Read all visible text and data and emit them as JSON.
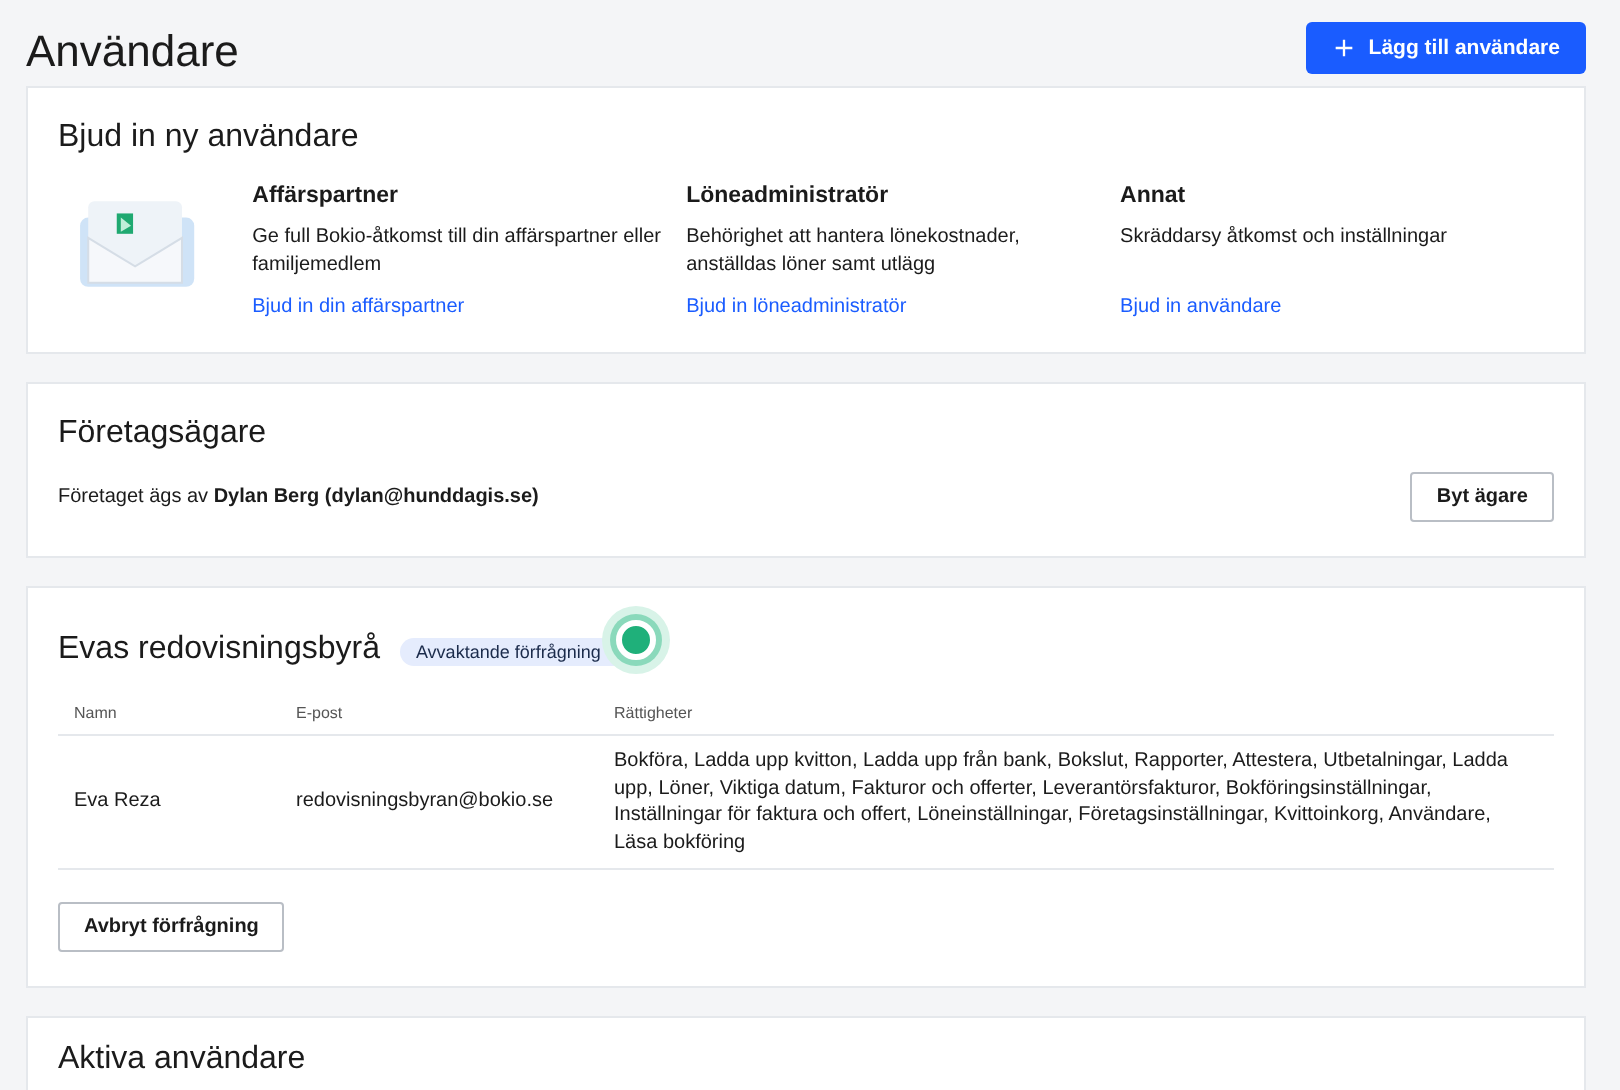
{
  "page": {
    "title": "Användare",
    "add_button": "Lägg till användare"
  },
  "invite": {
    "title": "Bjud in ny användare",
    "options": [
      {
        "title": "Affärspartner",
        "description": "Ge full Bokio-åtkomst till din affärspartner eller familjemedlem",
        "link": "Bjud in din affärspartner"
      },
      {
        "title": "Löneadministratör",
        "description": "Behörighet att hantera lönekostnader, anställdas löner samt utlägg",
        "link": "Bjud in löneadministratör"
      },
      {
        "title": "Annat",
        "description": "Skräddarsy åtkomst och inställningar",
        "link": "Bjud in användare"
      }
    ]
  },
  "owner": {
    "title": "Företagsägare",
    "text": "Företaget ägs av **Dylan Berg (dylan@hunddagis.se)**",
    "button": "Byt ägare"
  },
  "agency": {
    "title": "Evas redovisningsbyrå",
    "badge": "Avvaktande förfrågning",
    "table": {
      "columns": [
        "Namn",
        "E-post",
        "Rättigheter"
      ],
      "rows": [
        [
          "Eva Reza",
          "redovisningsbyran@bokio.se",
          "Bokföra, Ladda upp kvitton, Ladda upp från bank, Bokslut, Rapporter, Attestera, Utbetalningar, Ladda upp, Löner, Viktiga datum, Fakturor och offerter, Leverantörsfakturor, Bokföringsinställningar, Inställningar för faktura och offert, Löneinställningar, Företagsinställningar, Kvittoinkorg, Användare, Läsa bokföring"
        ]
      ]
    },
    "button": "Avbryt förfrågning"
  },
  "active_users": {
    "title": "Aktiva användare"
  }
}
